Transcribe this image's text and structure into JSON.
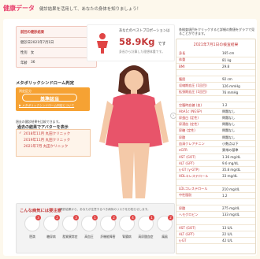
{
  "header": {
    "brand": "健康データ",
    "subtitle": "健診結果を活用して、あなたの身体を知りましょう！"
  },
  "profile": {
    "title": "前回の健診結果",
    "date_label": "健診日",
    "date": "2021年7月1日",
    "sex_label": "性別",
    "sex": "女",
    "age_label": "年齢",
    "age": "36"
  },
  "proportion": {
    "caption": "あなたのベストプロポーションは",
    "value": "58.9Kg",
    "unit": "です",
    "note": "身長から計算した理想体重です。"
  },
  "metabolic": {
    "title": "メタボリックシンドローム判定",
    "label": "判定区分",
    "text": "基準該当",
    "link": "▶ メタボリックシンドローム判定について"
  },
  "doctors": {
    "intro": "過去の健診結果を比較できます。",
    "title": "過去の結果でアバターを表示",
    "items": [
      "2018年11月 丸田クリニック",
      "2019年11月 丸田クリニック",
      "2021年7月 丸田クリニック"
    ]
  },
  "right_panel": {
    "note": "各検査項目をクリックすると詳細の数値をグラフで見ることができます。",
    "date": "2021年7月1日の検査結果",
    "rows": [
      [
        "身長",
        "165 cm"
      ],
      [
        "体重",
        "81 kg"
      ],
      [
        "BMI",
        "29.8"
      ],
      [
        "",
        ""
      ],
      [
        "腹囲",
        "92 cm"
      ],
      [
        "収縮期血圧 (1回目)",
        "126 mmHg"
      ],
      [
        "拡張期血圧 (1回目)",
        "76 mmHg"
      ],
      [
        "",
        ""
      ],
      [
        "空腹時血糖 (血)",
        "1.2"
      ],
      [
        "HbA1c (NGSP)",
        "問題なし"
      ],
      [
        "尿蛋白 (定性)",
        "問題なし"
      ],
      [
        "尿潜血 (定性)",
        "問題なし"
      ],
      [
        "尿糖 (定性)",
        "問題なし"
      ],
      [
        "尿酸",
        "問題なし"
      ],
      [
        "血清クレアチニン",
        "小数点以下"
      ],
      [
        "eGFR",
        "異常の基準"
      ],
      [
        "AST (GOT)",
        "1.36 mg/dL"
      ],
      [
        "ALT (GPT)",
        "9.6 mg/dL"
      ],
      [
        "γ-GT (γ-GTP)",
        "35.8 mg/dL"
      ],
      [
        "HDLコレステロール",
        "33 mg/dL"
      ],
      [
        "",
        ""
      ],
      [
        "LDLコレステロール",
        "210 mg/dL"
      ],
      [
        "中性脂肪",
        "1.2"
      ],
      [
        "",
        ""
      ],
      [
        "尿酸",
        "275 mg/dL"
      ],
      [
        "ヘモグロビン",
        "133 mg/dL"
      ],
      [
        "",
        ""
      ],
      [
        "AST (GOT)",
        "13 U/L"
      ],
      [
        "ALT (GPT)",
        "22 U/L"
      ],
      [
        "γ-GT",
        "42 U/L"
      ]
    ]
  },
  "illness": {
    "title": "こんな病気には要注意",
    "note": "健診結果から、あなたが注意するべき病気のリスクをお知らせします。",
    "items": [
      {
        "name": "肥満",
        "badge": "3"
      },
      {
        "name": "糖尿病",
        "badge": "2"
      },
      {
        "name": "脂質異常症",
        "badge": "3"
      },
      {
        "name": "高血圧",
        "badge": "1"
      },
      {
        "name": "肝機能障害",
        "badge": "2"
      },
      {
        "name": "腎臓病",
        "badge": "4"
      },
      {
        "name": "高尿酸血症",
        "badge": "1"
      },
      {
        "name": "痛風",
        "badge": "2"
      }
    ]
  },
  "colors": {
    "accent": "#e8426e",
    "orange": "#f6a233",
    "red": "#c43a3a"
  }
}
